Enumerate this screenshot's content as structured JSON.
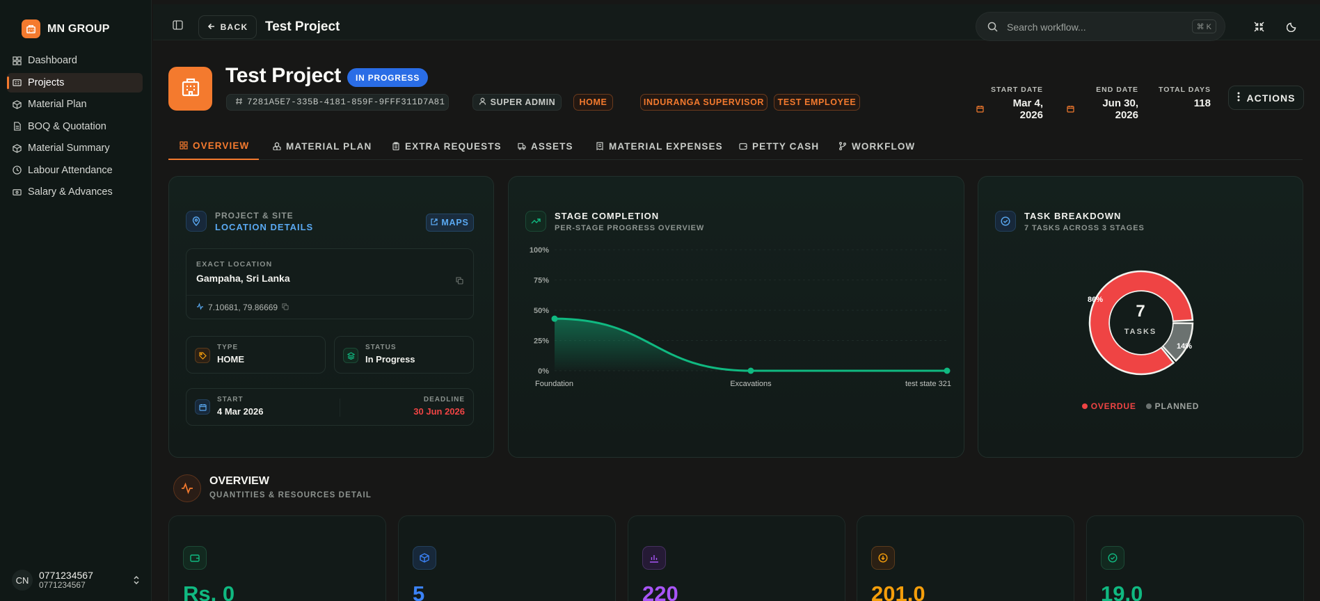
{
  "brand": {
    "name": "MN GROUP"
  },
  "sidebar": {
    "items": [
      {
        "label": "Dashboard"
      },
      {
        "label": "Projects"
      },
      {
        "label": "Material Plan"
      },
      {
        "label": "BOQ & Quotation"
      },
      {
        "label": "Material Summary"
      },
      {
        "label": "Labour Attendance"
      },
      {
        "label": "Salary & Advances"
      }
    ],
    "active_index": 1
  },
  "user": {
    "initials": "CN",
    "name": "0771234567",
    "sub": "0771234567"
  },
  "topbar": {
    "back_label": "BACK",
    "title": "Test Project",
    "search_placeholder": "Search workflow...",
    "shortcut": "⌘ K"
  },
  "project": {
    "title": "Test Project",
    "status": "IN PROGRESS",
    "id": "7281A5E7-335B-4181-859F-9FFF311D7A81",
    "role": "SUPER ADMIN",
    "type_tag": "HOME",
    "people": [
      "INDURANGA SUPERVISOR",
      "TEST EMPLOYEE"
    ],
    "start_date_label": "START DATE",
    "start_date": "Mar 4, 2026",
    "end_date_label": "END DATE",
    "end_date": "Jun 30, 2026",
    "total_days_label": "TOTAL DAYS",
    "total_days": "118",
    "actions_label": "ACTIONS"
  },
  "tabs": [
    "OVERVIEW",
    "MATERIAL PLAN",
    "EXTRA REQUESTS",
    "ASSETS",
    "MATERIAL EXPENSES",
    "PETTY CASH",
    "WORKFLOW"
  ],
  "active_tab": 0,
  "location_card": {
    "title1": "PROJECT & SITE",
    "title2": "LOCATION DETAILS",
    "maps_label": "MAPS",
    "exact_label": "EXACT LOCATION",
    "exact_value": "Gampaha, Sri Lanka",
    "coords": "7.10681, 79.86669",
    "type_label": "TYPE",
    "type_value": "HOME",
    "status_label": "STATUS",
    "status_value": "In Progress",
    "start_label": "START",
    "start_value": "4 Mar 2026",
    "deadline_label": "DEADLINE",
    "deadline_value": "30 Jun 2026"
  },
  "stage_card": {
    "title": "STAGE COMPLETION",
    "subtitle": "PER-STAGE PROGRESS OVERVIEW"
  },
  "task_card": {
    "title": "TASK BREAKDOWN",
    "subtitle": "7 TASKS ACROSS 3 STAGES",
    "center_value": "7",
    "center_label": "TASKS",
    "overdue_label": "OVERDUE",
    "planned_label": "PLANNED"
  },
  "chart_data": [
    {
      "type": "area",
      "x": [
        "Foundation",
        "Excavations",
        "test state 321"
      ],
      "series": [
        {
          "values": [
            43,
            0,
            0
          ]
        }
      ],
      "ylim": [
        0,
        100
      ],
      "yticks": [
        "100%",
        "75%",
        "50%",
        "25%",
        "0%"
      ],
      "colors": {
        "line": "#10b981"
      }
    },
    {
      "type": "pie",
      "categories": [
        "OVERDUE",
        "PLANNED"
      ],
      "values": [
        86,
        14
      ],
      "labels": [
        "86%",
        "14%"
      ],
      "colors": [
        "#ef4444",
        "#6b7270"
      ]
    }
  ],
  "overview": {
    "title": "OVERVIEW",
    "subtitle": "QUANTITIES & RESOURCES DETAIL"
  },
  "stats": [
    {
      "value": "Rs. 0",
      "icon": "wallet-icon",
      "color": "#10b981"
    },
    {
      "value": "5",
      "icon": "box-icon",
      "color": "#3b82f6"
    },
    {
      "value": "220",
      "icon": "bar-chart-icon",
      "color": "#a855f7"
    },
    {
      "value": "201.0",
      "icon": "download-icon",
      "color": "#f59e0b"
    },
    {
      "value": "19.0",
      "icon": "check-circle-icon",
      "color": "#10b981"
    }
  ],
  "colors": {
    "accent": "#f47a2e",
    "status_blue": "#2a6de6",
    "danger": "#ef4444",
    "info": "#5aa9f2"
  }
}
